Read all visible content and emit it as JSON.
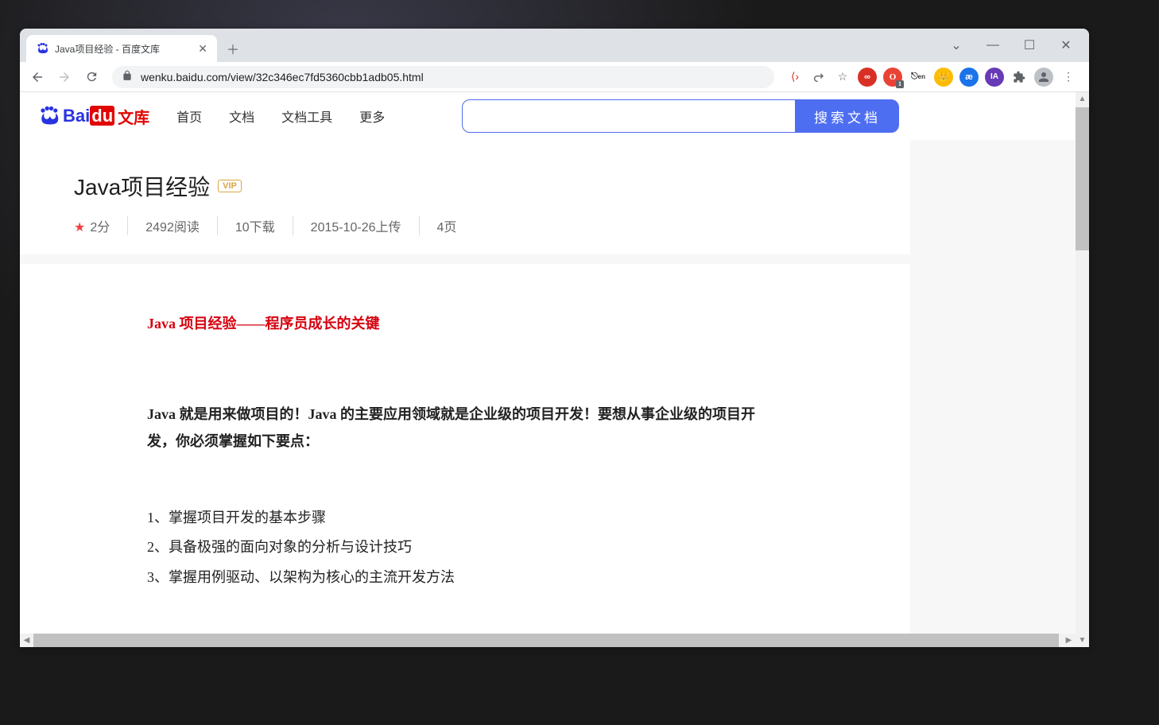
{
  "browser": {
    "tab_title": "Java项目经验 - 百度文库",
    "url_display": "wenku.baidu.com/view/32c346ec7fd5360cbb1adb05.html"
  },
  "site": {
    "logo_text1": "Bai",
    "logo_text2": "du",
    "logo_text3": "文库",
    "nav": [
      "首页",
      "文档",
      "文档工具",
      "更多"
    ],
    "search_btn": "搜索文档"
  },
  "document": {
    "title": "Java项目经验",
    "vip": "VIP",
    "rating": "2分",
    "reads": "2492阅读",
    "downloads": "10下载",
    "upload_date": "2015-10-26上传",
    "pages": "4页",
    "content_title_red": "Java 项目经验——程序员成长的关键",
    "content_p1": "Java 就是用来做项目的！Java 的主要应用领域就是企业级的项目开发！要想从事企业级的项目开发，你必须掌握如下要点：",
    "list_1": "1、掌握项目开发的基本步骤",
    "list_2": "2、具备极强的面向对象的分析与设计技巧",
    "list_3": "3、掌握用例驱动、以架构为核心的主流开发方法"
  },
  "ext_badge": "1"
}
